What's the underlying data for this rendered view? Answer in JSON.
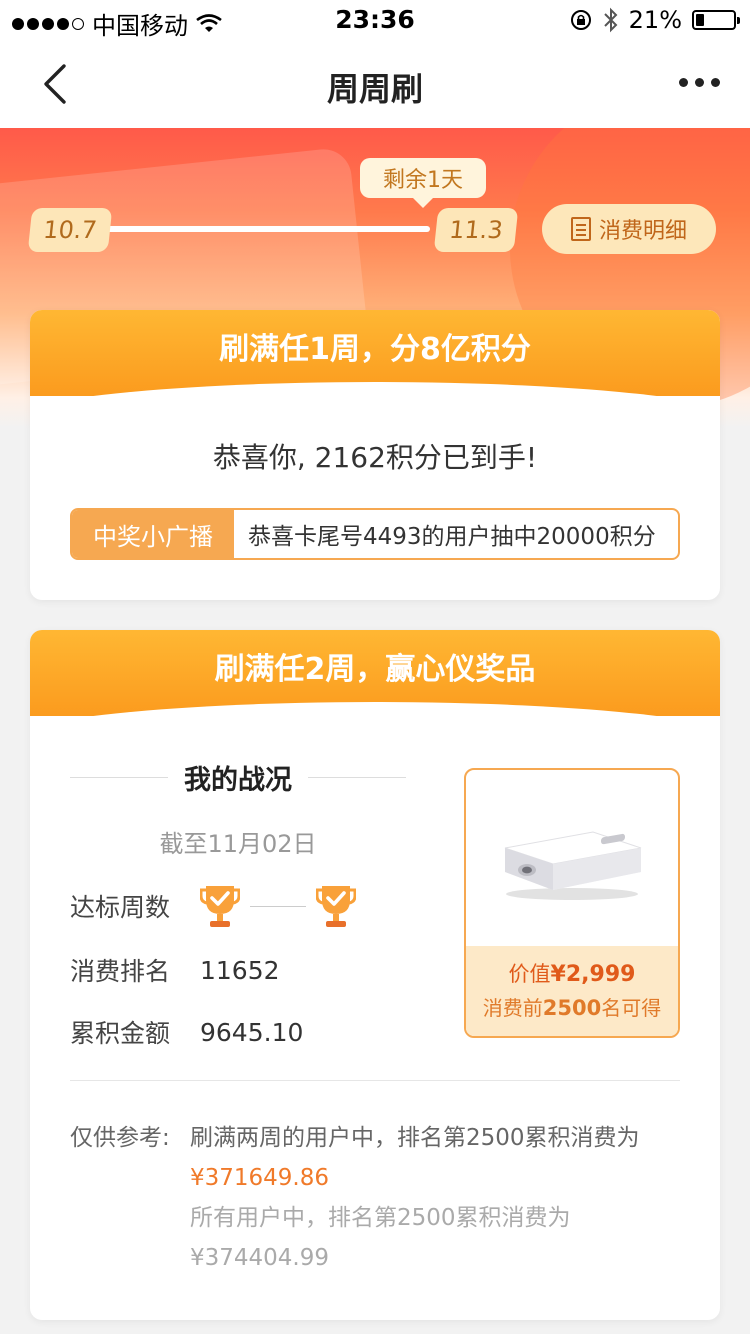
{
  "status_bar": {
    "carrier": "中国移动",
    "time": "23:36",
    "battery": "21%",
    "battery_level": 0.21
  },
  "nav": {
    "title": "周周刷",
    "back_icon": "chevron-left-icon",
    "more_icon": "more-dots-icon"
  },
  "hero": {
    "start_date": "10.7",
    "end_date": "11.3",
    "remaining": "剩余1天",
    "detail_button": "消费明细"
  },
  "card1": {
    "title": "刷满任1周，分8亿积分",
    "congrats": "恭喜你, 2162积分已到手!",
    "broadcast_label": "中奖小广播",
    "broadcast_text": "恭喜卡尾号4493的用户抽中20000积分"
  },
  "card2": {
    "title": "刷满任2周，赢心仪奖品",
    "section_title": "我的战况",
    "as_of": "截至11月02日",
    "weeks_label": "达标周数",
    "rank_label": "消费排名",
    "rank_value": "11652",
    "total_label": "累积金额",
    "total_value": "9645.10",
    "prize": {
      "price_prefix": "价值",
      "price": "¥2,999",
      "cond_prefix": "消费前",
      "cond_number": "2500",
      "cond_suffix": "名可得"
    },
    "ref_label": "仅供参考:",
    "ref_line1": "刷满两周的用户中，排名第2500累积消费为",
    "ref_value1": "¥371649.86",
    "ref_line2": "所有用户中，排名第2500累积消费为",
    "ref_value2": "¥374404.99"
  },
  "colors": {
    "accent": "#fb9b1e",
    "orange_text": "#f07a2a"
  }
}
